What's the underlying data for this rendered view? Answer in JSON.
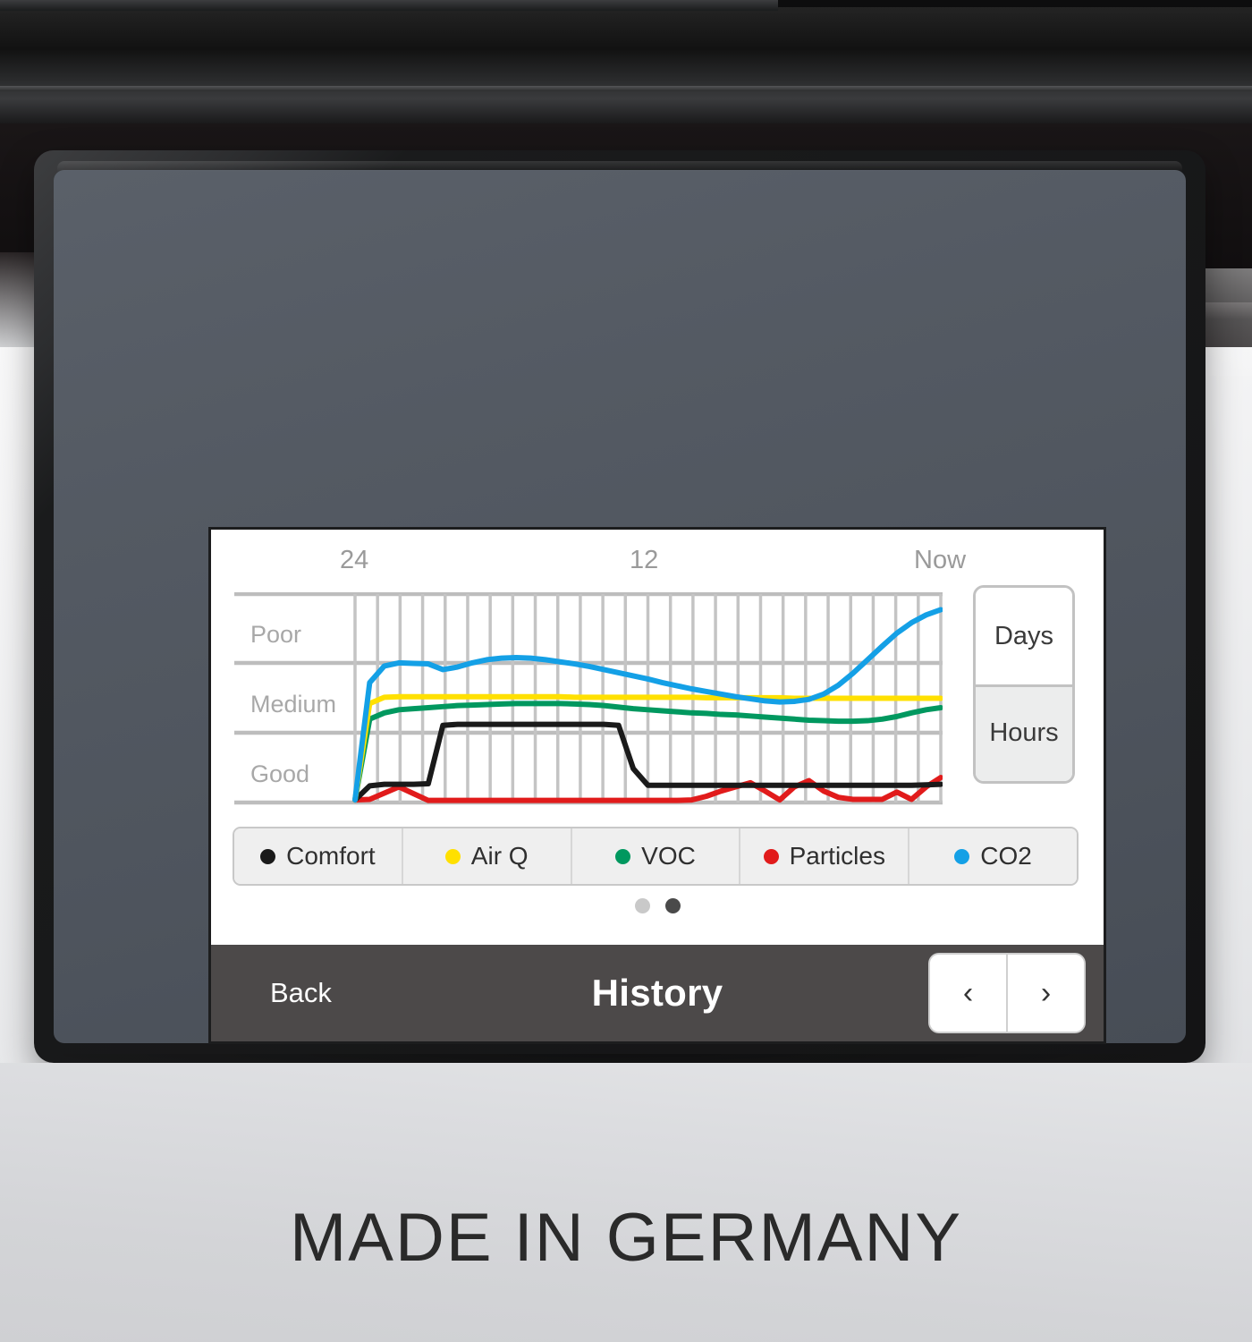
{
  "device": {
    "caption": "MADE IN GERMANY"
  },
  "screen": {
    "title": "History",
    "back_label": "Back",
    "nav": {
      "prev_icon": "chevron-left-icon",
      "prev_glyph": "‹",
      "next_icon": "chevron-right-icon",
      "next_glyph": "›"
    },
    "page_dots": [
      {
        "active": false
      },
      {
        "active": true
      }
    ]
  },
  "mode_toggle": {
    "options": [
      {
        "label": "Days",
        "selected": false
      },
      {
        "label": "Hours",
        "selected": true
      }
    ]
  },
  "legend": [
    {
      "label": "Comfort",
      "color": "#1a1a1a"
    },
    {
      "label": "Air Q",
      "color": "#ffe000"
    },
    {
      "label": "VOC",
      "color": "#00985f"
    },
    {
      "label": "Particles",
      "color": "#e11b1b"
    },
    {
      "label": "CO2",
      "color": "#14a0e6"
    }
  ],
  "chart_data": {
    "type": "line",
    "title": "History",
    "xlabel": "",
    "ylabel": "",
    "grid": true,
    "legend_position": "bottom",
    "x_tick_labels": [
      "24",
      "12",
      "Now"
    ],
    "x_tick_positions": [
      0,
      50,
      100
    ],
    "y_tick_labels": [
      "Poor",
      "Medium",
      "Good"
    ],
    "ylim": [
      0,
      4
    ],
    "y_band_values": {
      "Poor": 3,
      "Medium": 2,
      "Good": 1
    },
    "x": [
      0,
      2.5,
      5,
      7.5,
      10,
      12.5,
      15,
      17.5,
      20,
      22.5,
      25,
      27.5,
      30,
      32.5,
      35,
      37.5,
      40,
      42.5,
      45,
      47.5,
      50,
      52.5,
      55,
      57.5,
      60,
      62.5,
      65,
      67.5,
      70,
      72.5,
      75,
      77.5,
      80,
      82.5,
      85,
      87.5,
      90,
      92.5,
      95,
      97.5,
      100
    ],
    "series": [
      {
        "name": "Comfort",
        "color": "#1a1a1a",
        "values": [
          0.05,
          0.32,
          0.35,
          0.35,
          0.35,
          0.36,
          1.48,
          1.5,
          1.5,
          1.5,
          1.5,
          1.5,
          1.5,
          1.5,
          1.5,
          1.5,
          1.5,
          1.5,
          1.48,
          0.65,
          0.33,
          0.33,
          0.33,
          0.33,
          0.33,
          0.33,
          0.33,
          0.33,
          0.33,
          0.33,
          0.33,
          0.33,
          0.33,
          0.33,
          0.33,
          0.33,
          0.33,
          0.33,
          0.33,
          0.34,
          0.35
        ]
      },
      {
        "name": "Air Q",
        "color": "#ffe000",
        "values": [
          0.05,
          1.9,
          2.02,
          2.03,
          2.03,
          2.03,
          2.03,
          2.03,
          2.03,
          2.03,
          2.03,
          2.03,
          2.03,
          2.03,
          2.03,
          2.02,
          2.02,
          2.02,
          2.02,
          2.02,
          2.02,
          2.02,
          2.02,
          2.02,
          2.01,
          2.01,
          2.01,
          2.01,
          2.01,
          2.01,
          2.0,
          2.0,
          2.0,
          2.0,
          2.0,
          2.0,
          2.0,
          2.0,
          2.0,
          2.0,
          2.0
        ]
      },
      {
        "name": "VOC",
        "color": "#00985f",
        "values": [
          0.05,
          1.6,
          1.72,
          1.78,
          1.8,
          1.82,
          1.84,
          1.86,
          1.87,
          1.88,
          1.89,
          1.9,
          1.9,
          1.9,
          1.9,
          1.89,
          1.88,
          1.86,
          1.83,
          1.8,
          1.78,
          1.76,
          1.74,
          1.72,
          1.71,
          1.69,
          1.68,
          1.66,
          1.64,
          1.62,
          1.6,
          1.58,
          1.57,
          1.56,
          1.56,
          1.57,
          1.6,
          1.65,
          1.72,
          1.78,
          1.82
        ]
      },
      {
        "name": "Particles",
        "color": "#e11b1b",
        "values": [
          0.05,
          0.06,
          0.18,
          0.3,
          0.17,
          0.04,
          0.04,
          0.04,
          0.04,
          0.04,
          0.04,
          0.04,
          0.04,
          0.04,
          0.04,
          0.04,
          0.04,
          0.04,
          0.04,
          0.04,
          0.04,
          0.04,
          0.04,
          0.05,
          0.12,
          0.22,
          0.3,
          0.38,
          0.22,
          0.05,
          0.3,
          0.42,
          0.22,
          0.1,
          0.06,
          0.06,
          0.06,
          0.2,
          0.06,
          0.3,
          0.48
        ]
      },
      {
        "name": "CO2",
        "color": "#14a0e6"
      }
    ],
    "co2_values": [
      0.05,
      2.3,
      2.62,
      2.68,
      2.67,
      2.66,
      2.55,
      2.6,
      2.68,
      2.74,
      2.77,
      2.78,
      2.77,
      2.74,
      2.7,
      2.66,
      2.61,
      2.55,
      2.49,
      2.43,
      2.37,
      2.3,
      2.24,
      2.18,
      2.13,
      2.08,
      2.03,
      1.99,
      1.95,
      1.93,
      1.94,
      1.98,
      2.08,
      2.25,
      2.48,
      2.74,
      3.0,
      3.25,
      3.45,
      3.6,
      3.7
    ]
  }
}
